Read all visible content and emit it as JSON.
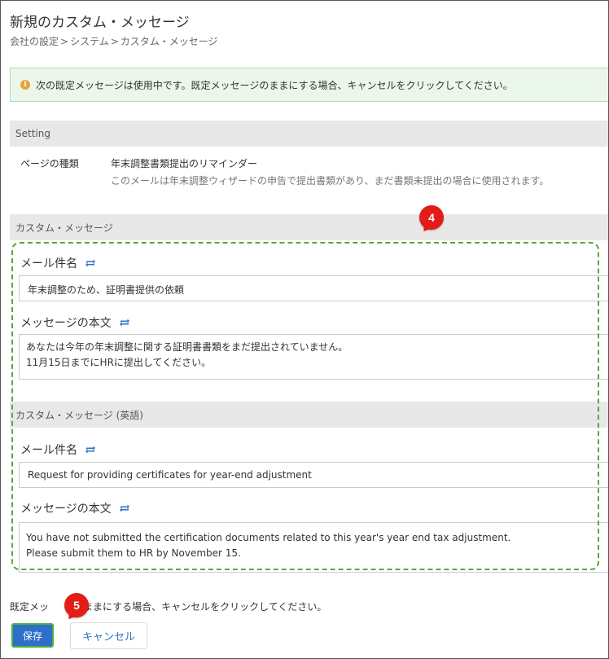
{
  "page": {
    "title": "新規のカスタム・メッセージ",
    "breadcrumb": [
      "会社の設定",
      "システム",
      "カスタム・メッセージ"
    ],
    "breadcrumb_separator": ">"
  },
  "alert": {
    "text": "次の既定メッセージは使用中です。既定メッセージのままにする場合、キャンセルをクリックしてください。",
    "icon": "info-icon"
  },
  "setting": {
    "header": "Setting",
    "page_type_label": "ページの種類",
    "page_type_value": "年末調整書類提出のリマインダー",
    "page_type_description": "このメールは年末調整ウィザードの申告で提出書類があり、まだ書類未提出の場合に使用されます。"
  },
  "custom_message": {
    "header": "カスタム・メッセージ",
    "subject_label": "メール件名",
    "subject_value": "年末調整のため、証明書提供の依頼",
    "body_label": "メッセージの本文",
    "body_lines": [
      "あなたは今年の年末調整に関する証明書書類をまだ提出されていません。",
      "11月15日までにHRに提出してください。"
    ]
  },
  "custom_message_en": {
    "header": "カスタム・メッセージ (英語)",
    "subject_label": "メール件名",
    "subject_value": "Request for providing certificates for year-end adjustment",
    "body_label": "メッセージの本文",
    "body_lines": [
      "You have not submitted the certification documents related to this year's year end tax adjustment.",
      "Please submit them to HR by November 15."
    ]
  },
  "footer": {
    "note_prefix": "既定メッ",
    "note_suffix": "ままにする場合、キャンセルをクリックしてください。",
    "save_label": "保存",
    "cancel_label": "キャンセル"
  },
  "callouts": {
    "four": "4",
    "five": "5"
  },
  "colors": {
    "accent": "#2e6fc9",
    "callout": "#e31c17",
    "highlight_border": "#5aa832",
    "alert_bg": "#eaf7ea"
  }
}
